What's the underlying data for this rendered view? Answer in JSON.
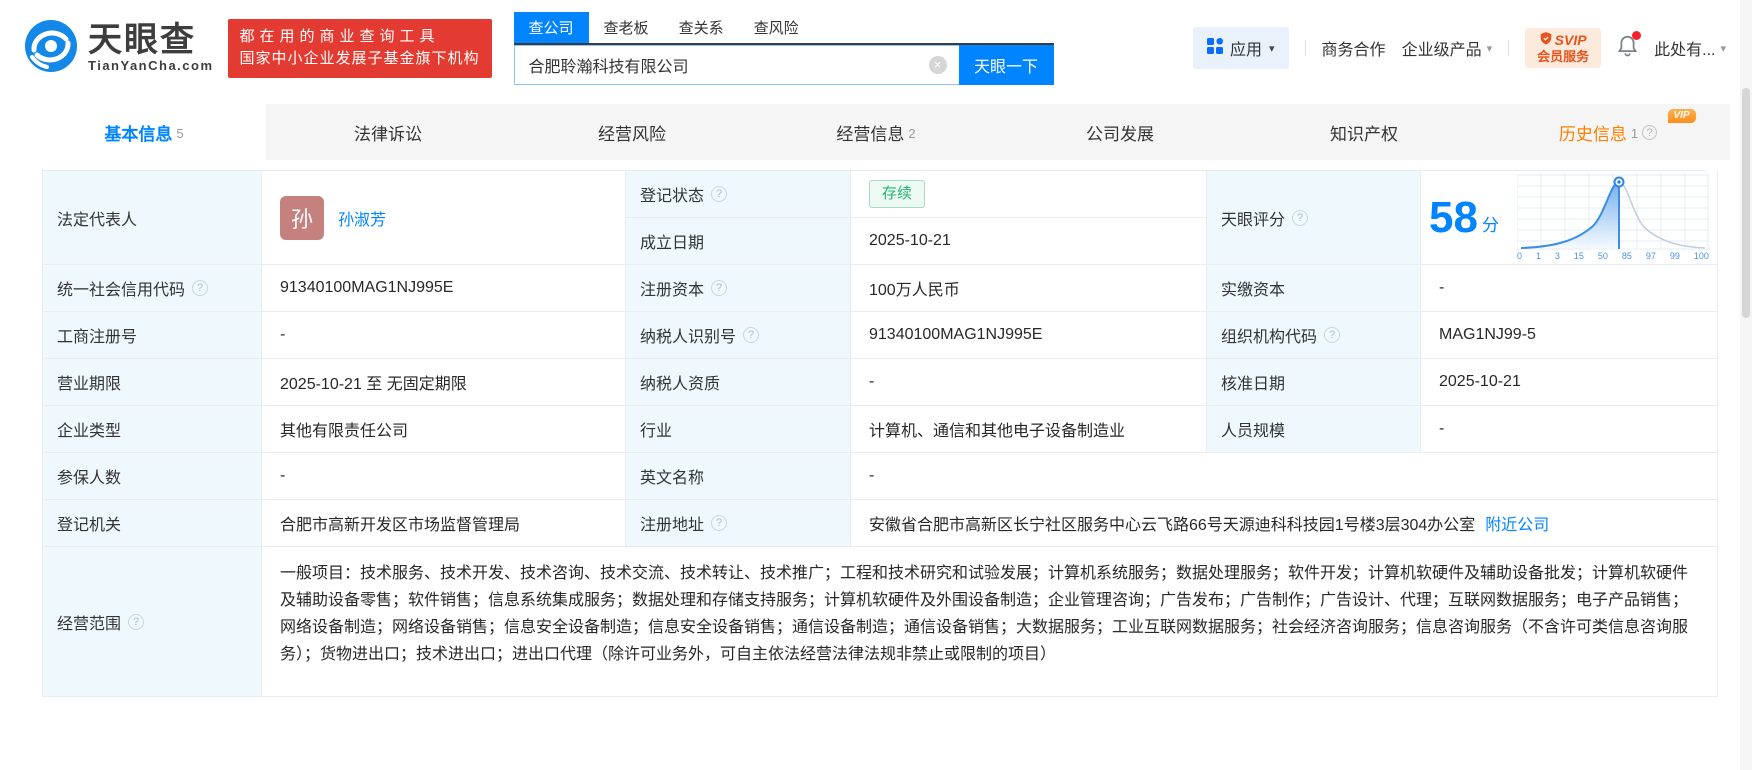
{
  "header": {
    "logo": {
      "title": "天眼查",
      "domain": "TianYanCha.com"
    },
    "banner": {
      "line1": "都在用的商业查询工具",
      "line2": "国家中小企业发展子基金旗下机构"
    },
    "search": {
      "tabs": [
        {
          "label": "查公司"
        },
        {
          "label": "查老板"
        },
        {
          "label": "查关系"
        },
        {
          "label": "查风险"
        }
      ],
      "value": "合肥聆瀚科技有限公司",
      "button_label": "天眼一下"
    },
    "nav": {
      "apps_label": "应用",
      "business_label": "商务合作",
      "enterprise_label": "企业级产品",
      "svip_top": "SVIP",
      "svip_bottom": "会员服务",
      "user_label": "此处有..."
    }
  },
  "tabs": [
    {
      "label": "基本信息",
      "count": "5"
    },
    {
      "label": "法律诉讼",
      "count": ""
    },
    {
      "label": "经营风险",
      "count": ""
    },
    {
      "label": "经营信息",
      "count": "2"
    },
    {
      "label": "公司发展",
      "count": ""
    },
    {
      "label": "知识产权",
      "count": ""
    },
    {
      "label": "历史信息",
      "count": "1",
      "vip": "VIP"
    }
  ],
  "info": {
    "legal_rep": {
      "label": "法定代表人",
      "avatar": "孙",
      "name": "孙淑芳"
    },
    "reg_status": {
      "label": "登记状态",
      "value": "存续"
    },
    "establish_date": {
      "label": "成立日期",
      "value": "2025-10-21"
    },
    "score": {
      "label": "天眼评分",
      "value": "58",
      "unit": "分"
    },
    "credit_code": {
      "label": "统一社会信用代码",
      "value": "91340100MAG1NJ995E"
    },
    "reg_capital": {
      "label": "注册资本",
      "value": "100万人民币"
    },
    "paid_capital": {
      "label": "实缴资本",
      "value": "-"
    },
    "reg_number": {
      "label": "工商注册号",
      "value": "-"
    },
    "taxpayer_id": {
      "label": "纳税人识别号",
      "value": "91340100MAG1NJ995E"
    },
    "org_code": {
      "label": "组织机构代码",
      "value": "MAG1NJ99-5"
    },
    "business_term": {
      "label": "营业期限",
      "value": "2025-10-21 至 无固定期限"
    },
    "taxpayer_qualification": {
      "label": "纳税人资质",
      "value": "-"
    },
    "approval_date": {
      "label": "核准日期",
      "value": "2025-10-21"
    },
    "company_type": {
      "label": "企业类型",
      "value": "其他有限责任公司"
    },
    "industry": {
      "label": "行业",
      "value": "计算机、通信和其他电子设备制造业"
    },
    "staff_size": {
      "label": "人员规模",
      "value": "-"
    },
    "insured_count": {
      "label": "参保人数",
      "value": "-"
    },
    "english_name": {
      "label": "英文名称",
      "value": "-"
    },
    "reg_authority": {
      "label": "登记机关",
      "value": "合肥市高新开发区市场监督管理局"
    },
    "reg_address": {
      "label": "注册地址",
      "value": "安徽省合肥市高新区长宁社区服务中心云飞路66号天源迪科科技园1号楼3层304办公室",
      "nearby_link": "附近公司"
    },
    "business_scope": {
      "label": "经营范围",
      "value": "一般项目：技术服务、技术开发、技术咨询、技术交流、技术转让、技术推广；工程和技术研究和试验发展；计算机系统服务；数据处理服务；软件开发；计算机软硬件及辅助设备批发；计算机软硬件及辅助设备零售；软件销售；信息系统集成服务；数据处理和存储支持服务；计算机软硬件及外围设备制造；企业管理咨询；广告发布；广告制作；广告设计、代理；互联网数据服务；电子产品销售；网络设备制造；网络设备销售；信息安全设备制造；信息安全设备销售；通信设备制造；通信设备销售；大数据服务；工业互联网数据服务；社会经济咨询服务；信息咨询服务（不含许可类信息咨询服务）；货物进出口；技术进出口；进出口代理（除许可业务外，可自主依法经营法律法规非禁止或限制的项目）"
    }
  },
  "score_chart": {
    "type": "area",
    "score": 58,
    "x_labels": [
      "0",
      "1",
      "3",
      "15",
      "50",
      "85",
      "97",
      "99",
      "100"
    ]
  },
  "icons": {
    "help": "?",
    "clear": "×",
    "caret": "▾"
  },
  "colors": {
    "primary_blue": "#0084ff",
    "banner_red": "#e33b31",
    "status_green": "#23b571",
    "history_orange": "#ff8000",
    "svip_orange": "#e8541e"
  }
}
